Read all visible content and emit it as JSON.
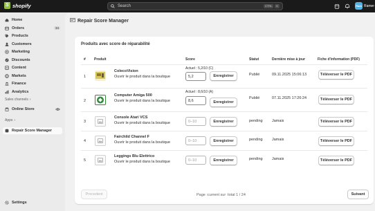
{
  "topbar": {
    "brand": "shopify",
    "search_placeholder": "Search",
    "shortcut_keys": [
      "CTRL",
      "K"
    ],
    "user_initials": "Ram",
    "user_name": "Ramer"
  },
  "sidebar": {
    "items": [
      {
        "label": "Home",
        "icon": "home-icon"
      },
      {
        "label": "Orders",
        "icon": "orders-icon",
        "badge": "34"
      },
      {
        "label": "Products",
        "icon": "tag-icon"
      },
      {
        "label": "Customers",
        "icon": "person-icon"
      },
      {
        "label": "Marketing",
        "icon": "target-icon"
      },
      {
        "label": "Discounts",
        "icon": "discount-icon"
      },
      {
        "label": "Content",
        "icon": "content-icon"
      },
      {
        "label": "Markets",
        "icon": "globe-icon"
      },
      {
        "label": "Finance",
        "icon": "bank-icon"
      },
      {
        "label": "Analytics",
        "icon": "chart-icon"
      }
    ],
    "sales_channels_label": "Sales channels",
    "online_store": "Online Store",
    "apps_label": "Apps",
    "app_item": "Repair Score Manager",
    "settings": "Settings"
  },
  "page": {
    "title": "Repair Score Manager",
    "card_title": "Produits avec score de réparabilité",
    "columns": [
      "#",
      "Produit",
      "Score",
      "Statut",
      "Dernière mise à jour",
      "Fiche d'information (PDF)"
    ],
    "view_link": "Ouvrir le produit dans la boutique",
    "save_label": "Enregistrer",
    "upload_label": "Téléverser le PDF",
    "score_placeholder": "0–10",
    "rows": [
      {
        "num": "1",
        "name": "ColecoVision",
        "current": "Actuel : 5,2/10 (C)",
        "score": "5,2",
        "status": "Publié",
        "date": "09.11.2025 15:06:13",
        "image": "colecovision-thumb"
      },
      {
        "num": "2",
        "name": "Computer Amiga 500",
        "current": "Actuel : 8,6/10 (A)",
        "score": "8,6",
        "status": "Publié",
        "date": "07.11.2025 17:26:24",
        "image": "amiga-thumb"
      },
      {
        "num": "3",
        "name": "Console Atari VCS",
        "current": "",
        "score": "",
        "status": "pending",
        "date": "Jamais",
        "image": "placeholder-image-icon"
      },
      {
        "num": "4",
        "name": "Fairchild Channel F",
        "current": "",
        "score": "",
        "status": "pending",
        "date": "Jamais",
        "image": "placeholder-image-icon"
      },
      {
        "num": "5",
        "name": "Leggings Blu Elettrico",
        "current": "",
        "score": "",
        "status": "pending",
        "date": "Jamais",
        "image": "placeholder-image-icon"
      }
    ],
    "pager": {
      "prev": "Precedent",
      "text": "Page :current sur :total 1 / 24",
      "next": "Suivant"
    }
  }
}
